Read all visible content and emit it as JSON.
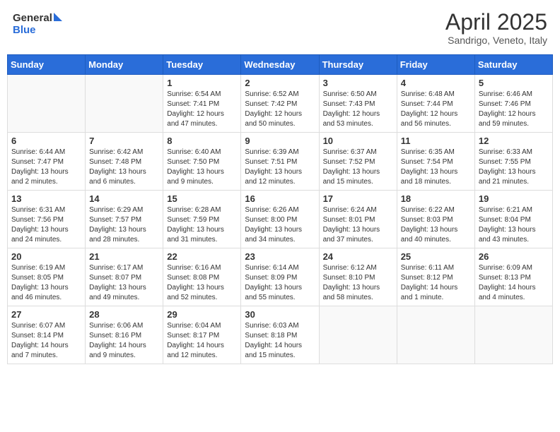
{
  "header": {
    "logo_line1": "General",
    "logo_line2": "Blue",
    "month_title": "April 2025",
    "location": "Sandrigo, Veneto, Italy"
  },
  "weekdays": [
    "Sunday",
    "Monday",
    "Tuesday",
    "Wednesday",
    "Thursday",
    "Friday",
    "Saturday"
  ],
  "weeks": [
    [
      {
        "day": "",
        "info": ""
      },
      {
        "day": "",
        "info": ""
      },
      {
        "day": "1",
        "info": "Sunrise: 6:54 AM\nSunset: 7:41 PM\nDaylight: 12 hours and 47 minutes."
      },
      {
        "day": "2",
        "info": "Sunrise: 6:52 AM\nSunset: 7:42 PM\nDaylight: 12 hours and 50 minutes."
      },
      {
        "day": "3",
        "info": "Sunrise: 6:50 AM\nSunset: 7:43 PM\nDaylight: 12 hours and 53 minutes."
      },
      {
        "day": "4",
        "info": "Sunrise: 6:48 AM\nSunset: 7:44 PM\nDaylight: 12 hours and 56 minutes."
      },
      {
        "day": "5",
        "info": "Sunrise: 6:46 AM\nSunset: 7:46 PM\nDaylight: 12 hours and 59 minutes."
      }
    ],
    [
      {
        "day": "6",
        "info": "Sunrise: 6:44 AM\nSunset: 7:47 PM\nDaylight: 13 hours and 2 minutes."
      },
      {
        "day": "7",
        "info": "Sunrise: 6:42 AM\nSunset: 7:48 PM\nDaylight: 13 hours and 6 minutes."
      },
      {
        "day": "8",
        "info": "Sunrise: 6:40 AM\nSunset: 7:50 PM\nDaylight: 13 hours and 9 minutes."
      },
      {
        "day": "9",
        "info": "Sunrise: 6:39 AM\nSunset: 7:51 PM\nDaylight: 13 hours and 12 minutes."
      },
      {
        "day": "10",
        "info": "Sunrise: 6:37 AM\nSunset: 7:52 PM\nDaylight: 13 hours and 15 minutes."
      },
      {
        "day": "11",
        "info": "Sunrise: 6:35 AM\nSunset: 7:54 PM\nDaylight: 13 hours and 18 minutes."
      },
      {
        "day": "12",
        "info": "Sunrise: 6:33 AM\nSunset: 7:55 PM\nDaylight: 13 hours and 21 minutes."
      }
    ],
    [
      {
        "day": "13",
        "info": "Sunrise: 6:31 AM\nSunset: 7:56 PM\nDaylight: 13 hours and 24 minutes."
      },
      {
        "day": "14",
        "info": "Sunrise: 6:29 AM\nSunset: 7:57 PM\nDaylight: 13 hours and 28 minutes."
      },
      {
        "day": "15",
        "info": "Sunrise: 6:28 AM\nSunset: 7:59 PM\nDaylight: 13 hours and 31 minutes."
      },
      {
        "day": "16",
        "info": "Sunrise: 6:26 AM\nSunset: 8:00 PM\nDaylight: 13 hours and 34 minutes."
      },
      {
        "day": "17",
        "info": "Sunrise: 6:24 AM\nSunset: 8:01 PM\nDaylight: 13 hours and 37 minutes."
      },
      {
        "day": "18",
        "info": "Sunrise: 6:22 AM\nSunset: 8:03 PM\nDaylight: 13 hours and 40 minutes."
      },
      {
        "day": "19",
        "info": "Sunrise: 6:21 AM\nSunset: 8:04 PM\nDaylight: 13 hours and 43 minutes."
      }
    ],
    [
      {
        "day": "20",
        "info": "Sunrise: 6:19 AM\nSunset: 8:05 PM\nDaylight: 13 hours and 46 minutes."
      },
      {
        "day": "21",
        "info": "Sunrise: 6:17 AM\nSunset: 8:07 PM\nDaylight: 13 hours and 49 minutes."
      },
      {
        "day": "22",
        "info": "Sunrise: 6:16 AM\nSunset: 8:08 PM\nDaylight: 13 hours and 52 minutes."
      },
      {
        "day": "23",
        "info": "Sunrise: 6:14 AM\nSunset: 8:09 PM\nDaylight: 13 hours and 55 minutes."
      },
      {
        "day": "24",
        "info": "Sunrise: 6:12 AM\nSunset: 8:10 PM\nDaylight: 13 hours and 58 minutes."
      },
      {
        "day": "25",
        "info": "Sunrise: 6:11 AM\nSunset: 8:12 PM\nDaylight: 14 hours and 1 minute."
      },
      {
        "day": "26",
        "info": "Sunrise: 6:09 AM\nSunset: 8:13 PM\nDaylight: 14 hours and 4 minutes."
      }
    ],
    [
      {
        "day": "27",
        "info": "Sunrise: 6:07 AM\nSunset: 8:14 PM\nDaylight: 14 hours and 7 minutes."
      },
      {
        "day": "28",
        "info": "Sunrise: 6:06 AM\nSunset: 8:16 PM\nDaylight: 14 hours and 9 minutes."
      },
      {
        "day": "29",
        "info": "Sunrise: 6:04 AM\nSunset: 8:17 PM\nDaylight: 14 hours and 12 minutes."
      },
      {
        "day": "30",
        "info": "Sunrise: 6:03 AM\nSunset: 8:18 PM\nDaylight: 14 hours and 15 minutes."
      },
      {
        "day": "",
        "info": ""
      },
      {
        "day": "",
        "info": ""
      },
      {
        "day": "",
        "info": ""
      }
    ]
  ]
}
